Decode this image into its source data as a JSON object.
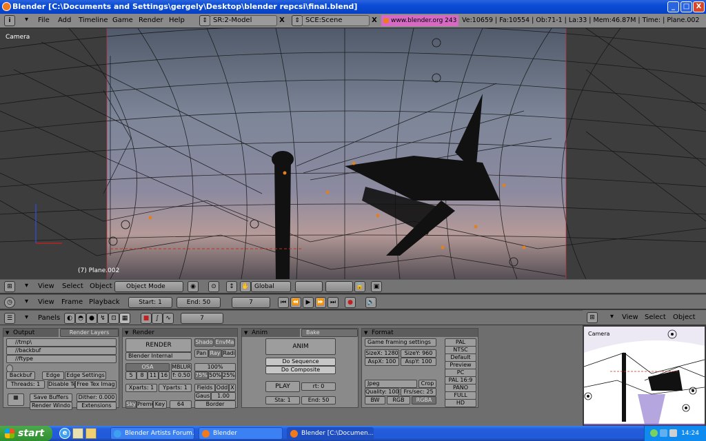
{
  "window": {
    "title": "Blender [C:\\Documents and Settings\\gergely\\Desktop\\blender repcsi\\final.blend]",
    "min": "_",
    "max": "□",
    "close": "X"
  },
  "menubar": {
    "items": [
      "File",
      "Add",
      "Timeline",
      "Game",
      "Render",
      "Help"
    ],
    "screen": "SR:2-Model",
    "scene": "SCE:Scene",
    "x": "X",
    "website": "www.blender.org 243",
    "stats": "Ve:10659 | Fa:10554 | Ob:71-1 | La:33  | Mem:46.87M  | Time: | Plane.002"
  },
  "viewport": {
    "label_camera": "Camera",
    "label_object": "(7) Plane.002"
  },
  "view3d_header": {
    "view": "View",
    "select": "Select",
    "object": "Object",
    "mode": "Object Mode",
    "orientation": "Global"
  },
  "timeline_header": {
    "view": "View",
    "frame": "Frame",
    "playback": "Playback",
    "start": "Start: 1",
    "end": "End: 50",
    "current": "7"
  },
  "buttons_header": {
    "panels": "Panels",
    "frame": "7"
  },
  "output_panel": {
    "tab1": "Output",
    "tab2": "Render Layers",
    "paths": [
      "//tmp\\",
      "//backbuf",
      "//ftype"
    ],
    "backbuf": "Backbuf",
    "edge": "Edge",
    "edge_settings": "Edge Settings",
    "threads": "Threads: 1",
    "disable_tex": "Disable Tex",
    "free_tex": "Free Tex Imag",
    "save_buffers": "Save Buffers",
    "dither": "Dither: 0.000",
    "render_window": "Render Windo",
    "extensions": "Extensions"
  },
  "render_panel": {
    "title": "Render",
    "render": "RENDER",
    "engine": "Blender Internal",
    "shadow": "Shado",
    "envmap": "EnvMa",
    "pano": "Pan",
    "ray": "Ray",
    "radio": "Radi",
    "osa": "OSA",
    "mblur": "MBLUR",
    "osa_levels": [
      "5",
      "8",
      "11",
      "16"
    ],
    "bf": "f: 0.50",
    "pct100": "100%",
    "pct75": "75%",
    "pct50": "50%",
    "pct25": "25%",
    "xparts": "Xparts: 1",
    "yparts": "Yparts: 1",
    "fields": "Fields",
    "odd": "Odd",
    "x": "X",
    "gauss": "Gaus",
    "gauss_val": "1.00",
    "sky": "Sky",
    "premul": "Premu",
    "key": "Key",
    "bits": "64",
    "border": "Border"
  },
  "anim_panel": {
    "tab1": "Anim",
    "tab2": "Bake",
    "anim": "ANIM",
    "do_sequence": "Do Sequence",
    "do_composite": "Do Composite",
    "play": "PLAY",
    "rt": "rt: 0",
    "sta": "Sta: 1",
    "end": "End: 50"
  },
  "format_panel": {
    "title": "Format",
    "game_framing": "Game framing settings",
    "sizex": "SizeX: 1280",
    "sizey": "SizeY: 960",
    "aspx": "AspX: 100",
    "aspy": "AspY: 100",
    "presets": [
      "PAL",
      "NTSC",
      "Default",
      "Preview",
      "PC",
      "PAL 16:9",
      "PANO",
      "FULL",
      "HD"
    ],
    "codec": "Jpeg",
    "crop": "Crop",
    "quality": "Quality: 100",
    "fps": "Frs/sec: 25",
    "bw": "BW",
    "rgb": "RGB",
    "rgba": "RGBA"
  },
  "preview_header": {
    "view": "View",
    "select": "Select",
    "object": "Object",
    "camera": "Camera"
  },
  "taskbar": {
    "start": "start",
    "tasks": [
      "Blender Artists Forum...",
      "Blender",
      "Blender [C:\\Documen..."
    ],
    "clock": "14:24"
  }
}
